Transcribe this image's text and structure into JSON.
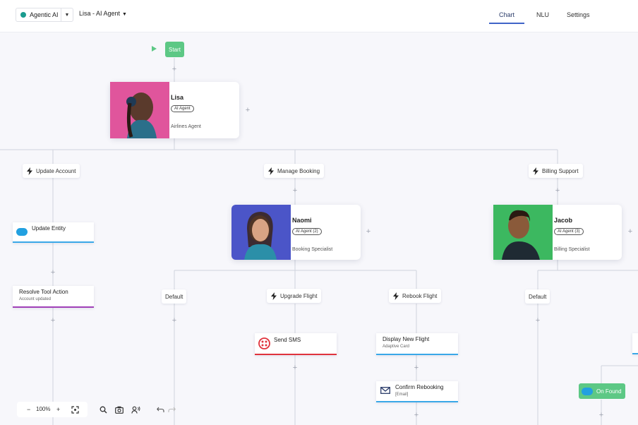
{
  "header": {
    "agent_select": "Agentic AI",
    "flow_select": "Lisa - AI Agent",
    "tabs": [
      {
        "label": "Chart",
        "active": true
      },
      {
        "label": "NLU",
        "active": false
      },
      {
        "label": "Settings",
        "active": false
      }
    ],
    "accent_color": "#3f64c8"
  },
  "flow": {
    "start_label": "Start",
    "agents": [
      {
        "name": "Lisa",
        "badge": "AI Agent",
        "role": "Airlines Agent",
        "color": "#e0559c"
      },
      {
        "name": "Naomi",
        "badge": "AI Agent (2)",
        "role": "Booking Specialist",
        "color": "#4b55c8"
      },
      {
        "name": "Jacob",
        "badge": "AI Agent (3)",
        "role": "Billing Specialist",
        "color": "#3cb860"
      }
    ],
    "intents": {
      "update_account": "Update Account",
      "manage_booking": "Manage Booking",
      "billing_support": "Billing Support",
      "upgrade_flight": "Upgrade Flight",
      "rebook_flight": "Rebook Flight",
      "default_1": "Default",
      "default_2": "Default"
    },
    "actions": {
      "update_entity": {
        "title": "Update Entity"
      },
      "resolve_tool": {
        "title": "Resolve Tool Action",
        "sub": "Account updated"
      },
      "send_sms": {
        "title": "Send SMS"
      },
      "display_flight": {
        "title": "Display New Flight",
        "sub": "Adaptive Card"
      },
      "confirm_rebooking": {
        "title": "Confirm Rebooking",
        "sub": "[Email]"
      }
    },
    "on_found": "On Found"
  },
  "toolbar": {
    "zoom": "100%",
    "zoom_out": "−",
    "zoom_in": "+"
  },
  "icons": [
    "play-icon",
    "bolt-icon",
    "salesforce-icon",
    "twilio-icon",
    "email-icon",
    "fit-screen-icon",
    "search-icon",
    "camera-icon",
    "voice-icon",
    "undo-icon",
    "redo-icon"
  ]
}
